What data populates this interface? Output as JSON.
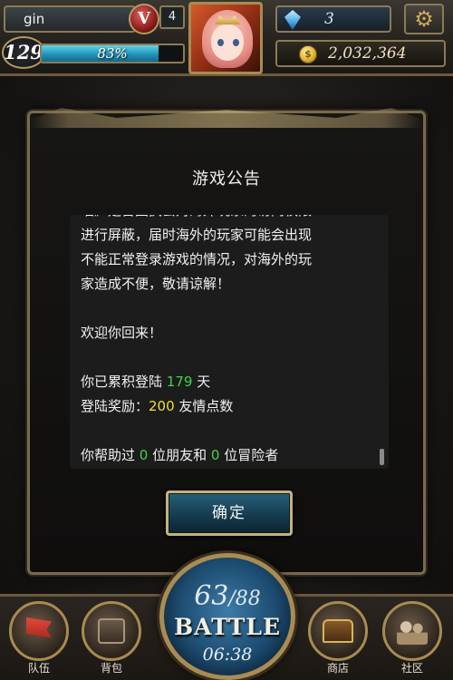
{
  "player": {
    "name": "gin",
    "rank_badge": "V",
    "rank_number": "4",
    "level": "129",
    "exp_percent": "83%",
    "exp_fraction": 0.83
  },
  "currency": {
    "gems": "3",
    "gold": "2,032,364",
    "coin_symbol": "$"
  },
  "icons": {
    "settings": "gear-icon",
    "gem": "gem-icon",
    "coin": "coin-icon"
  },
  "notice": {
    "title": "游戏公告",
    "line_partial": "唱》是否因执会对海外玩家的访问权限",
    "line1": "进行屏蔽，届时海外的玩家可能会出现",
    "line2": "不能正常登录游戏的情况，对海外的玩",
    "line3": "家造成不便，敬请谅解！",
    "welcome": "欢迎你回来！",
    "login_prefix": "你已累积登陆 ",
    "login_days": "179",
    "login_suffix": " 天",
    "reward_prefix": "登陆奖励：",
    "reward_points": "200",
    "reward_suffix": " 友情点数",
    "help_prefix": "你帮助过 ",
    "help_friends": "0",
    "help_mid": " 位朋友和 ",
    "help_adventurers": "0",
    "help_suffix": " 位冒险者",
    "confirm_label": "确定"
  },
  "battle": {
    "stamina_current": "63",
    "stamina_max": "/88",
    "label": "BATTLE",
    "timer": "06:38"
  },
  "nav": {
    "team": "队伍",
    "bag": "背包",
    "shop": "商店",
    "community": "社区"
  },
  "colors": {
    "highlight_green": "#46d14a",
    "highlight_yellow": "#f2de3c",
    "frame_gold": "#a88b52",
    "button_blue": "#27607a"
  }
}
